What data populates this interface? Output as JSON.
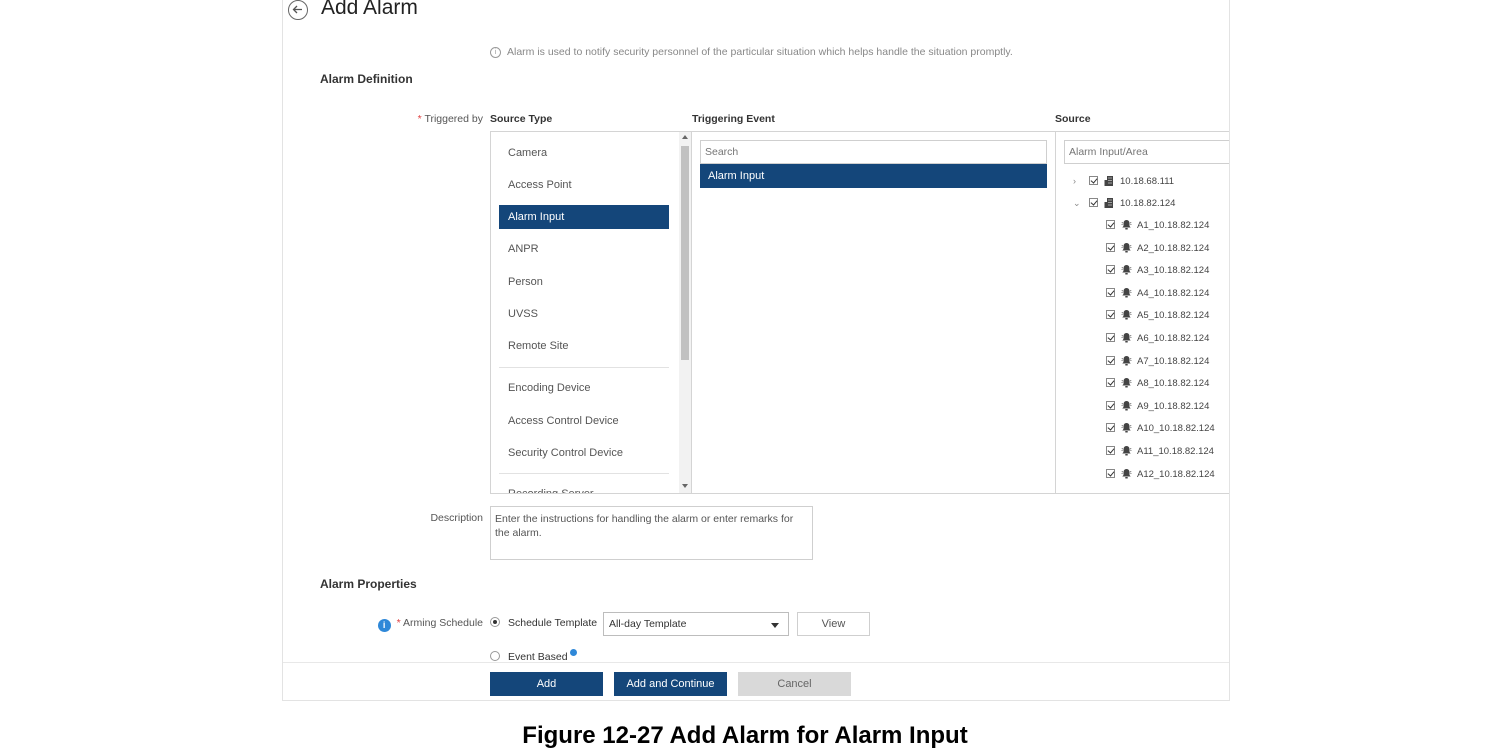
{
  "header": {
    "title": "Add Alarm"
  },
  "hint": "Alarm is used to notify security personnel of the particular situation which helps handle the situation promptly.",
  "sections": {
    "definition": "Alarm Definition",
    "properties": "Alarm Properties"
  },
  "triggered_by": {
    "required_mark": "*",
    "label": "Triggered by",
    "columns": {
      "source_type": "Source Type",
      "triggering_event": "Triggering Event",
      "source": "Source"
    },
    "source_types": [
      "Camera",
      "Access Point",
      "Alarm Input",
      "ANPR",
      "Person",
      "UVSS",
      "Remote Site",
      "Encoding Device",
      "Access Control Device",
      "Security Control Device",
      "Recording Server"
    ],
    "selected_source_type": "Alarm Input",
    "event_search_placeholder": "Search",
    "events": [
      "Alarm Input"
    ],
    "source_search_placeholder": "Alarm Input/Area",
    "tree": [
      {
        "label": "10.18.68.111",
        "expanded": false,
        "checked": true
      },
      {
        "label": "10.18.82.124",
        "expanded": true,
        "checked": true,
        "children": [
          "A1_10.18.82.124",
          "A2_10.18.82.124",
          "A3_10.18.82.124",
          "A4_10.18.82.124",
          "A5_10.18.82.124",
          "A6_10.18.82.124",
          "A7_10.18.82.124",
          "A8_10.18.82.124",
          "A9_10.18.82.124",
          "A10_10.18.82.124",
          "A11_10.18.82.124",
          "A12_10.18.82.124"
        ]
      }
    ]
  },
  "description": {
    "label": "Description",
    "placeholder": "Enter the instructions for handling the alarm or enter remarks for the alarm."
  },
  "arming_schedule": {
    "required_mark": "*",
    "label": "Arming Schedule",
    "option_template": "Schedule Template",
    "option_event": "Event Based",
    "template_value": "All-day Template",
    "view_label": "View"
  },
  "footer": {
    "add": "Add",
    "add_continue": "Add and Continue",
    "cancel": "Cancel"
  },
  "caption": "Figure 12-27 Add Alarm for Alarm Input",
  "colors": {
    "primary": "#14467a",
    "info": "#2f88d8",
    "required": "#e04040"
  }
}
